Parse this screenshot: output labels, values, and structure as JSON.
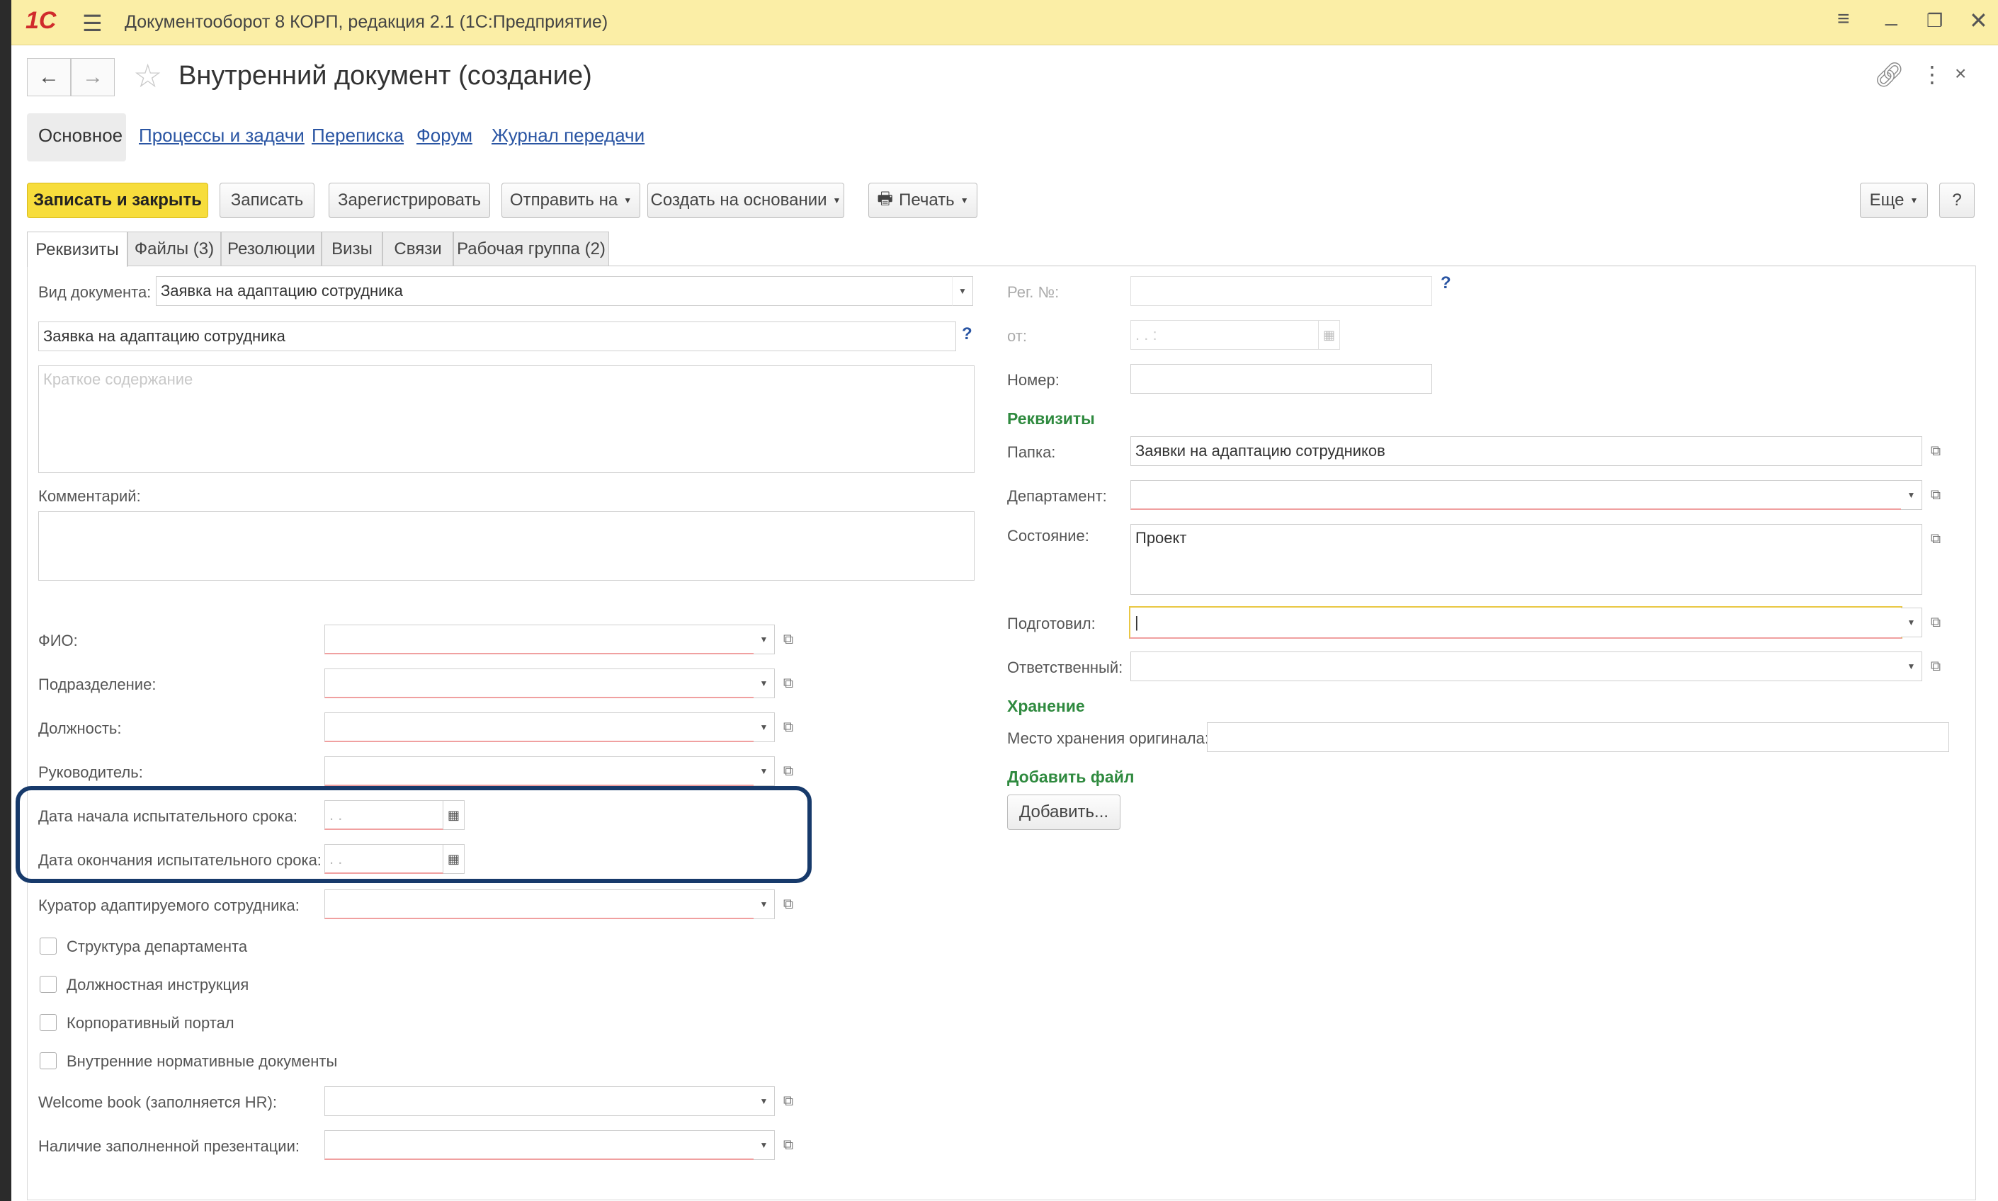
{
  "app": {
    "title": "Документооборот 8 КОРП, редакция 2.1  (1С:Предприятие)",
    "logo": "1С"
  },
  "doc": {
    "title": "Внутренний документ (создание)"
  },
  "nav_tabs": [
    "Основное",
    "Процессы и задачи",
    "Переписка",
    "Форум",
    "Журнал передачи"
  ],
  "toolbar": {
    "save_close": "Записать и закрыть",
    "save": "Записать",
    "register": "Зарегистрировать",
    "send": "Отправить на",
    "create_based": "Создать на основании",
    "print": "Печать",
    "more": "Еще",
    "help": "?"
  },
  "page_tabs": [
    "Реквизиты",
    "Файлы (3)",
    "Резолюции",
    "Визы",
    "Связи",
    "Рабочая группа (2)"
  ],
  "left": {
    "doc_type_label": "Вид документа:",
    "doc_type_value": "Заявка на адаптацию сотрудника",
    "title_value": "Заявка на адаптацию сотрудника",
    "summary_placeholder": "Краткое содержание",
    "comment_label": "Комментарий:",
    "fio": "ФИО:",
    "division": "Подразделение:",
    "position": "Должность:",
    "manager": "Руководитель:",
    "trial_start": "Дата начала испытательного срока:",
    "trial_end": "Дата окончания испытательного срока:",
    "date_mask": " .  .",
    "curator": "Куратор адаптируемого сотрудника:",
    "checkboxes": [
      "Структура департамента",
      "Должностная инструкция",
      "Корпоративный портал",
      "Внутренние нормативные документы"
    ],
    "welcome_book": "Welcome book (заполняется HR):",
    "presentation": "Наличие заполненной презентации:"
  },
  "right": {
    "reg_no": "Рег. №:",
    "from": "от:",
    "from_mask": " .  .     :",
    "number": "Номер:",
    "section_props": "Реквизиты",
    "folder_label": "Папка:",
    "folder_value": "Заявки на адаптацию сотрудников",
    "dept_label": "Департамент:",
    "state_label": "Состояние:",
    "state_value": "Проект",
    "prepared_label": "Подготовил:",
    "responsible_label": "Ответственный:",
    "section_storage": "Хранение",
    "storage_label": "Место хранения оригинала:",
    "section_add_file": "Добавить файл",
    "add_button": "Добавить..."
  },
  "icons": {
    "menu": "hamburger-icon",
    "star": "star-icon",
    "link": "link-icon",
    "more": "more-vert-icon",
    "close": "close-icon",
    "printer": "printer-icon",
    "calendar": "calendar-icon",
    "open": "open-icon",
    "dropdown": "dropdown-arrow-icon"
  },
  "colors": {
    "titlebar": "#fbeea6",
    "primary_button": "#f7dd3c",
    "link": "#2a55a3",
    "section": "#2f8a3f",
    "highlight": "#173a6b",
    "required_underline": "#f0a0a0"
  }
}
